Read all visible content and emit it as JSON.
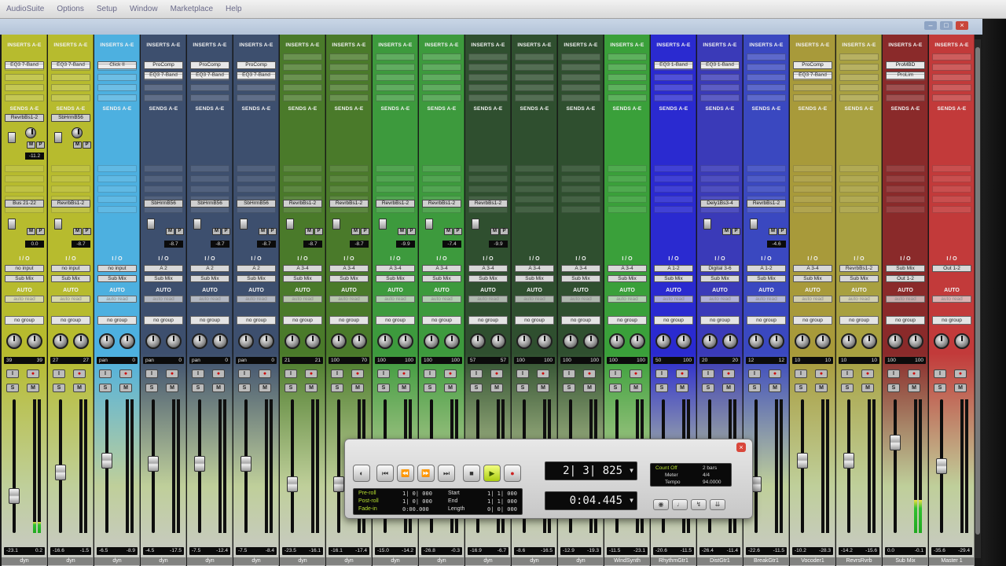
{
  "menu": [
    "AudioSuite",
    "Options",
    "Setup",
    "Window",
    "Marketplace",
    "Help"
  ],
  "window_buttons": {
    "minimize": "–",
    "maximize": "□",
    "close": "×"
  },
  "labels": {
    "inserts": "INSERTS A-E",
    "sends": "SENDS A-E",
    "io": "I / O",
    "auto": "AUTO",
    "auto_read": "auto read",
    "no_group": "no group",
    "dyn": "dyn"
  },
  "strips": [
    {
      "color": "#b7bb2e",
      "insert": [
        "EQ3 7-Band"
      ],
      "send": "RevrbBs1-2",
      "bus": "Bus 21-22",
      "sendvol": "-11.2",
      "sendvol2": "0.0",
      "io": [
        "no input",
        "Sub Mix"
      ],
      "pan": [
        "39",
        "39"
      ],
      "vol": [
        "-23.1",
        "0.2"
      ],
      "name": "",
      "fader": 0.25,
      "meter": 0.08
    },
    {
      "color": "#b7bb2e",
      "insert": [
        "EQ3 7-Band"
      ],
      "send": "SbHrmB56",
      "bus": "RevrbBs1-2",
      "sendvol": "",
      "sendvol2": "-8.7",
      "io": [
        "no input",
        "Sub Mix"
      ],
      "pan": [
        "27",
        "27"
      ],
      "vol": [
        "-16.6",
        "-1.5"
      ],
      "name": "",
      "fader": 0.45,
      "meter": 0.0
    },
    {
      "color": "#4db0e0",
      "insert": [
        "Click II"
      ],
      "send": "",
      "bus": "",
      "sendvol": "",
      "sendvol2": "",
      "io": [
        "no input",
        "Sub Mix"
      ],
      "pan": [
        "pan",
        "0"
      ],
      "vol": [
        "-6.5",
        "-8.9"
      ],
      "name": "",
      "fader": 0.55,
      "meter": 0.0
    },
    {
      "color": "#3d4f6e",
      "insert": [
        "ProComp",
        "EQ3 7-Band"
      ],
      "send": "",
      "bus": "SbHrmB56",
      "sendvol": "",
      "sendvol2": "-8.7",
      "io": [
        "A 2",
        "Sub Mix"
      ],
      "pan": [
        "pan",
        "0"
      ],
      "vol": [
        "-4.5",
        "-17.5"
      ],
      "name": "",
      "fader": 0.52,
      "meter": 0.0
    },
    {
      "color": "#3d4f6e",
      "insert": [
        "ProComp",
        "EQ3 7-Band"
      ],
      "send": "",
      "bus": "SbHrmB56",
      "sendvol": "",
      "sendvol2": "-8.7",
      "io": [
        "A 2",
        "Sub Mix"
      ],
      "pan": [
        "pan",
        "0"
      ],
      "vol": [
        "-7.5",
        "-12.4"
      ],
      "name": "",
      "fader": 0.52,
      "meter": 0.0
    },
    {
      "color": "#3d4f6e",
      "insert": [
        "ProComp",
        "EQ3 7-Band"
      ],
      "send": "",
      "bus": "SbHrmB56",
      "sendvol": "",
      "sendvol2": "-8.7",
      "io": [
        "A 2",
        "Sub Mix"
      ],
      "pan": [
        "pan",
        "0"
      ],
      "vol": [
        "-7.5",
        "-8.4"
      ],
      "name": "",
      "fader": 0.52,
      "meter": 0.0
    },
    {
      "color": "#4a7a2a",
      "insert": [],
      "send": "",
      "bus": "RevrbBs1-2",
      "sendvol": "",
      "sendvol2": "-8.7",
      "io": [
        "A 3-4",
        "Sub Mix"
      ],
      "pan": [
        "21",
        "21"
      ],
      "vol": [
        "-23.5",
        "-16.1"
      ],
      "name": "",
      "fader": 0.35,
      "meter": 0.0
    },
    {
      "color": "#4a7a2a",
      "insert": [],
      "send": "",
      "bus": "RevrbBs1-2",
      "sendvol": "",
      "sendvol2": "-8.7",
      "io": [
        "A 3-4",
        "Sub Mix"
      ],
      "pan": [
        "100",
        "70"
      ],
      "vol": [
        "-16.1",
        "-17.4"
      ],
      "name": "",
      "fader": 0.35,
      "meter": 0.0
    },
    {
      "color": "#3d9a3d",
      "insert": [],
      "send": "",
      "bus": "RevrbBs1-2",
      "sendvol": "",
      "sendvol2": "-9.9",
      "io": [
        "A 3-4",
        "Sub Mix"
      ],
      "pan": [
        "100",
        "100"
      ],
      "vol": [
        "-15.0",
        "-14.2"
      ],
      "name": "",
      "fader": 0.35,
      "meter": 0.0
    },
    {
      "color": "#3d9a3d",
      "insert": [],
      "send": "",
      "bus": "RevrbBs1-2",
      "sendvol": "",
      "sendvol2": "-7.4",
      "io": [
        "A 3-4",
        "Sub Mix"
      ],
      "pan": [
        "100",
        "100"
      ],
      "vol": [
        "-26.8",
        "-0.3"
      ],
      "name": "",
      "fader": 0.35,
      "meter": 0.0
    },
    {
      "color": "#2f4f2f",
      "insert": [],
      "send": "",
      "bus": "RevrbBs1-2",
      "sendvol": "",
      "sendvol2": "-9.9",
      "io": [
        "A 3-4",
        "Sub Mix"
      ],
      "pan": [
        "57",
        "57"
      ],
      "vol": [
        "-16.9",
        "-6.7"
      ],
      "name": "",
      "fader": 0.35,
      "meter": 0.0
    },
    {
      "color": "#2f4f2f",
      "insert": [],
      "send": "",
      "bus": "",
      "sendvol": "",
      "sendvol2": "",
      "io": [
        "A 3-4",
        "Sub Mix"
      ],
      "pan": [
        "100",
        "100"
      ],
      "vol": [
        "-8.6",
        "-16.5"
      ],
      "name": "",
      "fader": 0.35,
      "meter": 0.0
    },
    {
      "color": "#2f4f2f",
      "insert": [],
      "send": "",
      "bus": "",
      "sendvol": "",
      "sendvol2": "",
      "io": [
        "A 3-4",
        "Sub Mix"
      ],
      "pan": [
        "100",
        "100"
      ],
      "vol": [
        "-12.9",
        "-19.3"
      ],
      "name": "",
      "fader": 0.35,
      "meter": 0.0
    },
    {
      "color": "#3aa03a",
      "insert": [],
      "send": "",
      "bus": "",
      "sendvol": "",
      "sendvol2": "",
      "io": [
        "A 3-4",
        "Sub Mix"
      ],
      "pan": [
        "100",
        "100"
      ],
      "vol": [
        "-11.5",
        "-23.1"
      ],
      "name": "WindSynth",
      "fader": 0.35,
      "meter": 0.0
    },
    {
      "color": "#2a2ad0",
      "insert": [
        "EQ3 1-Band"
      ],
      "send": "",
      "bus": "",
      "sendvol": "",
      "sendvol2": "",
      "io": [
        "A 1-2",
        "Sub Mix"
      ],
      "pan": [
        "50",
        "100"
      ],
      "vol": [
        "-20.6",
        "-11.5"
      ],
      "name": "RhythmGtr1",
      "fader": 0.35,
      "meter": 0.0
    },
    {
      "color": "#3a3ab8",
      "insert": [
        "EQ3 1-Band"
      ],
      "send": "",
      "bus": "Dely1Bs3-4",
      "sendvol": "",
      "sendvol2": "",
      "io": [
        "Digital 3-6",
        "Sub Mix"
      ],
      "pan": [
        "20",
        "20"
      ],
      "vol": [
        "-26.4",
        "-11.4"
      ],
      "name": "DistGtr1",
      "fader": 0.35,
      "meter": 0.0
    },
    {
      "color": "#3a48c0",
      "insert": [],
      "send": "",
      "bus": "RevrbBs1-2",
      "sendvol": "",
      "sendvol2": "-4.6",
      "io": [
        "A 1-2",
        "Sub Mix"
      ],
      "pan": [
        "12",
        "12"
      ],
      "vol": [
        "-22.6",
        "-11.5"
      ],
      "name": "BreakGtr1",
      "fader": 0.35,
      "meter": 0.0
    },
    {
      "color": "#a89a3a",
      "insert": [
        "ProComp",
        "EQ3 7-Band"
      ],
      "send": "",
      "bus": "",
      "sendvol": "",
      "sendvol2": "",
      "io": [
        "A 3-4",
        "Sub Mix"
      ],
      "pan": [
        "10",
        "10"
      ],
      "vol": [
        "-10.2",
        "-28.3"
      ],
      "name": "Vocoder1",
      "fader": 0.55,
      "meter": 0.0
    },
    {
      "color": "#a8a040",
      "insert": [],
      "send": "",
      "bus": "",
      "sendvol": "",
      "sendvol2": "",
      "io": [
        "RevrbBs1-2",
        "Sub Mix"
      ],
      "pan": [
        "10",
        "10"
      ],
      "vol": [
        "-14.2",
        "-15.6"
      ],
      "name": "RevrsRvrb",
      "fader": 0.55,
      "meter": 0.0
    },
    {
      "color": "#8a2a2a",
      "insert": [
        "ProMBD",
        "ProLim"
      ],
      "send": "",
      "bus": "",
      "sendvol": "",
      "sendvol2": "",
      "io": [
        "Sub Mix",
        "Out 1-2"
      ],
      "pan": [
        "100",
        "100"
      ],
      "vol": [
        "0.0",
        "-0.1"
      ],
      "name": "Sub Mix",
      "fader": 0.7,
      "meter": 0.25
    },
    {
      "color": "#c23a3a",
      "insert": [],
      "send": "",
      "bus": "",
      "sendvol": "",
      "sendvol2": "",
      "io": [
        "Out 1-2",
        ""
      ],
      "pan": [
        "",
        ""
      ],
      "vol": [
        "-35.6",
        "-29.4"
      ],
      "name": "Master 1",
      "fader": 0.5,
      "meter": 0.0
    }
  ],
  "transport": {
    "close": "×",
    "counter_main": "2| 3| 825",
    "counter_sub": "0:04.445",
    "preroll_label": "Pre-roll",
    "postroll_label": "Post-roll",
    "fadein_label": "Fade-in",
    "preroll": "1| 0| 000",
    "postroll": "1| 0| 000",
    "fadein": "0:00.000",
    "start_label": "Start",
    "end_label": "End",
    "length_label": "Length",
    "start": "1| 1| 000",
    "end": "1| 1| 000",
    "length": "0| 0| 000",
    "count_label": "Count Off",
    "count_val": "2 bars",
    "meter_label": "Meter",
    "meter_val": "4/4",
    "tempo_label": "Tempo",
    "tempo_val": "94.0000"
  }
}
